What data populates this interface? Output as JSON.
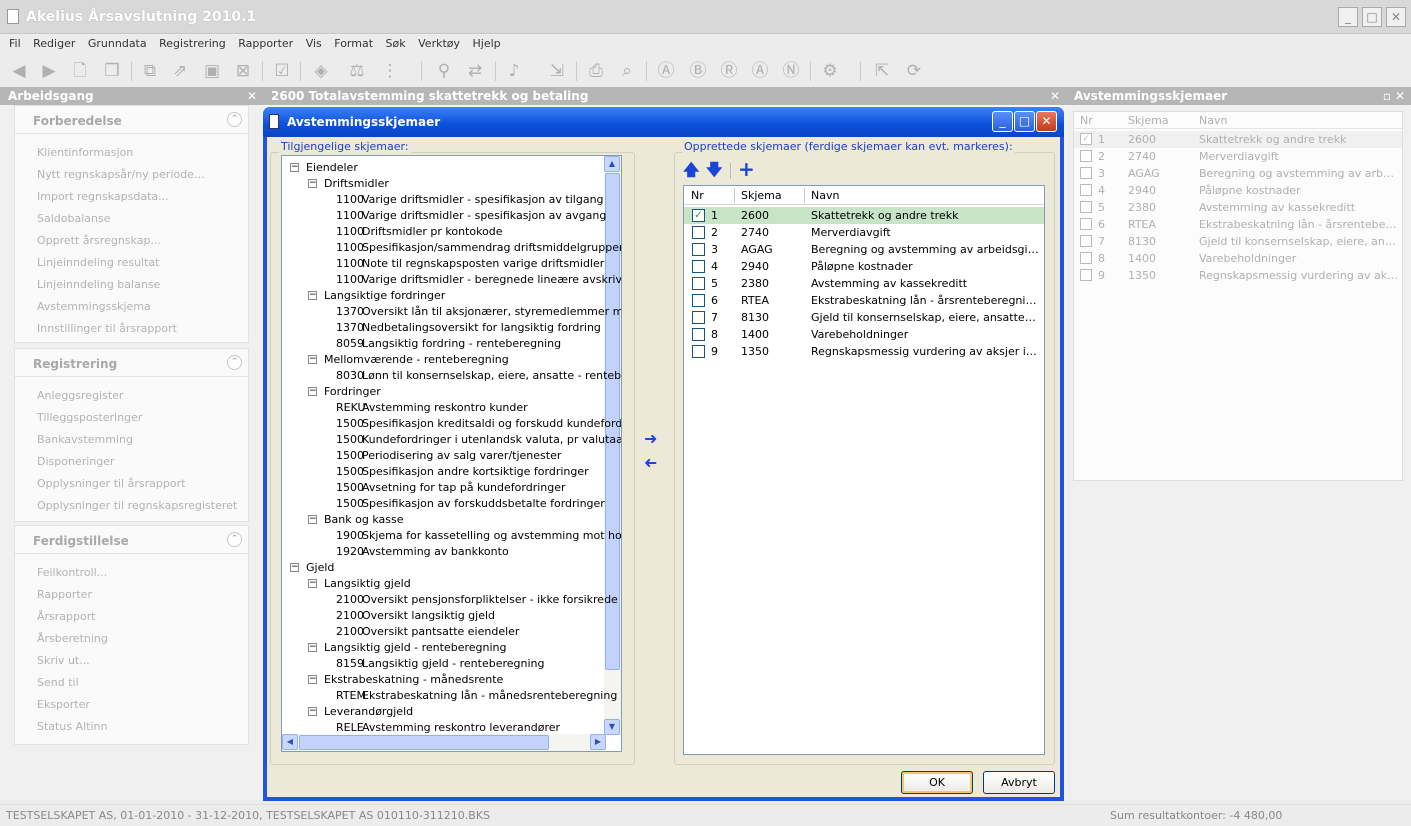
{
  "app": {
    "title": "Akelius Årsavslutning 2010.1"
  },
  "menu": [
    "Fil",
    "Rediger",
    "Grunndata",
    "Registrering",
    "Rapporter",
    "Vis",
    "Format",
    "Søk",
    "Verktøy",
    "Hjelp"
  ],
  "left_pane": {
    "title": "Arbeidsgang",
    "groups": [
      {
        "title": "Forberedelse",
        "items": [
          "Klientinformasjon",
          "Nytt regnskapsår/ny periode...",
          "Import regnskapsdata...",
          "Saldobalanse",
          "Opprett årsregnskap...",
          "Linjeinndeling resultat",
          "Linjeinndeling balanse",
          "Avstemmingsskjema",
          "Innstillinger til årsrapport"
        ]
      },
      {
        "title": "Registrering",
        "items": [
          "Anleggsregister",
          "Tilleggsposteringer",
          "Bankavstemming",
          "Disponeringer",
          "Opplysninger til årsrapport",
          "Opplysninger til regnskapsregisteret"
        ]
      },
      {
        "title": "Ferdigstillelse",
        "items": [
          "Feilkontroll...",
          "Rapporter",
          "Årsrapport",
          "Årsberetning",
          "Skriv ut...",
          "Send til",
          "Eksporter",
          "Status Altinn"
        ]
      }
    ]
  },
  "document_tab": {
    "title": "2600 Totalavstemming skattetrekk og betaling"
  },
  "right_pane": {
    "title": "Avstemmingsskjemaer",
    "columns": [
      "Nr",
      "Skjema",
      "Navn"
    ],
    "rows": [
      {
        "nr": "1",
        "skjema": "2600",
        "navn": "Skattetrekk og andre trekk",
        "checked": true
      },
      {
        "nr": "2",
        "skjema": "2740",
        "navn": "Merverdiavgift",
        "checked": false
      },
      {
        "nr": "3",
        "skjema": "AGAG",
        "navn": "Beregning og avstemming av arbeidsgi...",
        "checked": false
      },
      {
        "nr": "4",
        "skjema": "2940",
        "navn": "Påløpne kostnader",
        "checked": false
      },
      {
        "nr": "5",
        "skjema": "2380",
        "navn": "Avstemming av kassekreditt",
        "checked": false
      },
      {
        "nr": "6",
        "skjema": "RTEA",
        "navn": "Ekstrabeskatning lån - årsrenteberegn...",
        "checked": false
      },
      {
        "nr": "7",
        "skjema": "8130",
        "navn": "Gjeld til konsernselskap, eiere, ansatt...",
        "checked": false
      },
      {
        "nr": "8",
        "skjema": "1400",
        "navn": "Varebeholdninger",
        "checked": false
      },
      {
        "nr": "9",
        "skjema": "1350",
        "navn": "Regnskapsmessig vurdering av aksjer ...",
        "checked": false
      }
    ]
  },
  "dialog": {
    "title": "Avstemmingsskjemaer",
    "available_label": "Tilgjengelige skjemaer:",
    "created_label": "Opprettede skjemaer (ferdige skjemaer kan evt. markeres):",
    "tree": [
      {
        "level": 0,
        "code": "",
        "text": "Eiendeler",
        "expander": "−"
      },
      {
        "level": 1,
        "code": "",
        "text": "Driftsmidler",
        "expander": "−"
      },
      {
        "level": 2,
        "code": "1100",
        "text": "Varige driftsmidler - spesifikasjon av tilgang",
        "expander": ""
      },
      {
        "level": 2,
        "code": "1100",
        "text": "Varige driftsmidler - spesifikasjon av avgang",
        "expander": ""
      },
      {
        "level": 2,
        "code": "1100",
        "text": "Driftsmidler pr kontokode",
        "expander": ""
      },
      {
        "level": 2,
        "code": "1100",
        "text": "Spesifikasjon/sammendrag driftsmiddelgrupper",
        "expander": ""
      },
      {
        "level": 2,
        "code": "1100",
        "text": "Note til regnskapsposten varige driftsmidler",
        "expander": ""
      },
      {
        "level": 2,
        "code": "1100",
        "text": "Varige driftsmidler - beregnede lineære avskrivn",
        "expander": ""
      },
      {
        "level": 1,
        "code": "",
        "text": "Langsiktige fordringer",
        "expander": "−"
      },
      {
        "level": 2,
        "code": "1370",
        "text": "Oversikt lån til aksjonærer, styremedlemmer mv",
        "expander": ""
      },
      {
        "level": 2,
        "code": "1370",
        "text": "Nedbetalingsoversikt for langsiktig fordring",
        "expander": ""
      },
      {
        "level": 2,
        "code": "8059",
        "text": "Langsiktig fordring - renteberegning",
        "expander": ""
      },
      {
        "level": 1,
        "code": "",
        "text": "Mellomværende - renteberegning",
        "expander": "−"
      },
      {
        "level": 2,
        "code": "8030",
        "text": "Lønn til konsernselskap, eiere, ansatte - renteb",
        "expander": ""
      },
      {
        "level": 1,
        "code": "",
        "text": "Fordringer",
        "expander": "−"
      },
      {
        "level": 2,
        "code": "REKU",
        "text": "Avstemming reskontro kunder",
        "expander": ""
      },
      {
        "level": 2,
        "code": "1500",
        "text": "Spesifikasjon kreditsaldi og forskudd kundefordr",
        "expander": ""
      },
      {
        "level": 2,
        "code": "1500",
        "text": "Kundefordringer i utenlandsk valuta, pr valutaa",
        "expander": ""
      },
      {
        "level": 2,
        "code": "1500",
        "text": "Periodisering av salg varer/tjenester",
        "expander": ""
      },
      {
        "level": 2,
        "code": "1500",
        "text": "Spesifikasjon andre kortsiktige fordringer",
        "expander": ""
      },
      {
        "level": 2,
        "code": "1500",
        "text": "Avsetning for tap på kundefordringer",
        "expander": ""
      },
      {
        "level": 2,
        "code": "1500",
        "text": "Spesifikasjon av forskuddsbetalte fordringer",
        "expander": ""
      },
      {
        "level": 1,
        "code": "",
        "text": "Bank og kasse",
        "expander": "−"
      },
      {
        "level": 2,
        "code": "1900",
        "text": "Skjema for kassetelling og avstemming mot hove",
        "expander": ""
      },
      {
        "level": 2,
        "code": "1920",
        "text": "Avstemming av bankkonto",
        "expander": ""
      },
      {
        "level": 0,
        "code": "",
        "text": "Gjeld",
        "expander": "−"
      },
      {
        "level": 1,
        "code": "",
        "text": "Langsiktig gjeld",
        "expander": "−"
      },
      {
        "level": 2,
        "code": "2100",
        "text": "Oversikt pensjonsforpliktelser - ikke forsikrede",
        "expander": ""
      },
      {
        "level": 2,
        "code": "2100",
        "text": "Oversikt langsiktig gjeld",
        "expander": ""
      },
      {
        "level": 2,
        "code": "2100",
        "text": "Oversikt pantsatte eiendeler",
        "expander": ""
      },
      {
        "level": 1,
        "code": "",
        "text": "Langsiktig gjeld - renteberegning",
        "expander": "−"
      },
      {
        "level": 2,
        "code": "8159",
        "text": "Langsiktig gjeld - renteberegning",
        "expander": ""
      },
      {
        "level": 1,
        "code": "",
        "text": "Ekstrabeskatning - månedsrente",
        "expander": "−"
      },
      {
        "level": 2,
        "code": "RTEM",
        "text": "Ekstrabeskatning lån - månedsrenteberegning",
        "expander": ""
      },
      {
        "level": 1,
        "code": "",
        "text": "Leverandørgjeld",
        "expander": "−"
      },
      {
        "level": 2,
        "code": "RELE",
        "text": "Avstemming reskontro leverandører",
        "expander": ""
      }
    ],
    "list_columns": [
      "Nr",
      "Skjema",
      "Navn"
    ],
    "list_rows": [
      {
        "nr": "1",
        "skjema": "2600",
        "navn": "Skattetrekk og andre trekk",
        "checked": true
      },
      {
        "nr": "2",
        "skjema": "2740",
        "navn": "Merverdiavgift",
        "checked": false
      },
      {
        "nr": "3",
        "skjema": "AGAG",
        "navn": "Beregning og avstemming av arbeidsgiverav...",
        "checked": false
      },
      {
        "nr": "4",
        "skjema": "2940",
        "navn": "Påløpne kostnader",
        "checked": false
      },
      {
        "nr": "5",
        "skjema": "2380",
        "navn": "Avstemming av kassekreditt",
        "checked": false
      },
      {
        "nr": "6",
        "skjema": "RTEA",
        "navn": "Ekstrabeskatning lån - årsrenteberegning",
        "checked": false
      },
      {
        "nr": "7",
        "skjema": "8130",
        "navn": "Gjeld til konsernselskap, eiere, ansatte - ren...",
        "checked": false
      },
      {
        "nr": "8",
        "skjema": "1400",
        "navn": "Varebeholdninger",
        "checked": false
      },
      {
        "nr": "9",
        "skjema": "1350",
        "navn": "Regnskapsmessig vurdering av aksjer i andr...",
        "checked": false
      }
    ],
    "ok_label": "OK",
    "cancel_label": "Avbryt"
  },
  "status": {
    "left": "TESTSELSKAPET AS, 01-01-2010 - 31-12-2010, TESTSELSKAPET AS 010110-311210.BKS",
    "right": "Sum resultatkontoer: -4 480,00"
  },
  "colors": {
    "dialog_blue": "#1f55e0",
    "selected_row": "#c8e4c7",
    "label_blue": "#1a3fc3"
  }
}
